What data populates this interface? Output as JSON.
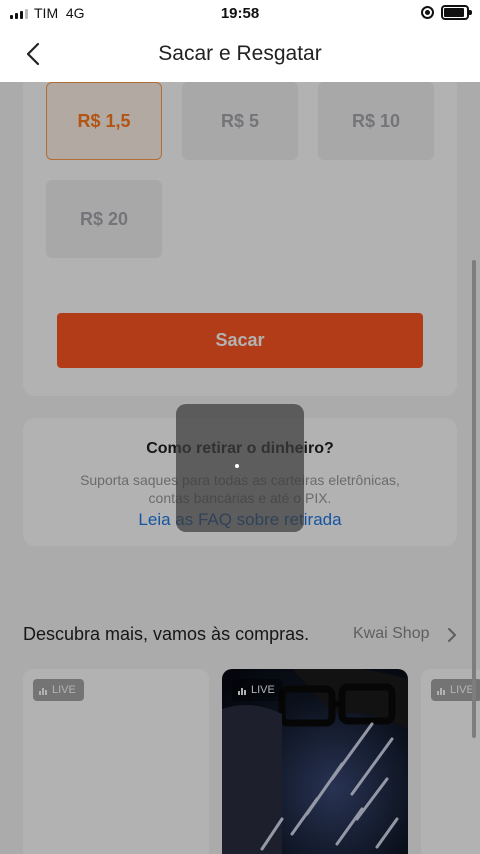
{
  "status_bar": {
    "carrier": "TIM",
    "network": "4G",
    "time": "19:58"
  },
  "header": {
    "title": "Sacar e Resgatar",
    "back_icon": "chevron-left-icon"
  },
  "withdraw": {
    "amounts": [
      {
        "label": "R$ 1,5",
        "selected": true
      },
      {
        "label": "R$ 5",
        "selected": false
      },
      {
        "label": "R$ 10",
        "selected": false
      },
      {
        "label": "R$ 20",
        "selected": false
      }
    ],
    "button_label": "Sacar"
  },
  "faq": {
    "title": "Como retirar o dinheiro?",
    "description_line1": "Suporta saques para todas as carteiras eletrônicas,",
    "description_line2": "contas bancárias e até o PIX.",
    "link": "Leia as FAQ sobre retirada"
  },
  "shop": {
    "title": "Descubra mais, vamos às compras.",
    "link": "Kwai Shop",
    "live_label": "LIVE"
  },
  "colors": {
    "accent": "#ff5722",
    "selected_border": "#ff9c4c",
    "selected_text": "#ff7a1e",
    "link": "#1f7ae8"
  }
}
